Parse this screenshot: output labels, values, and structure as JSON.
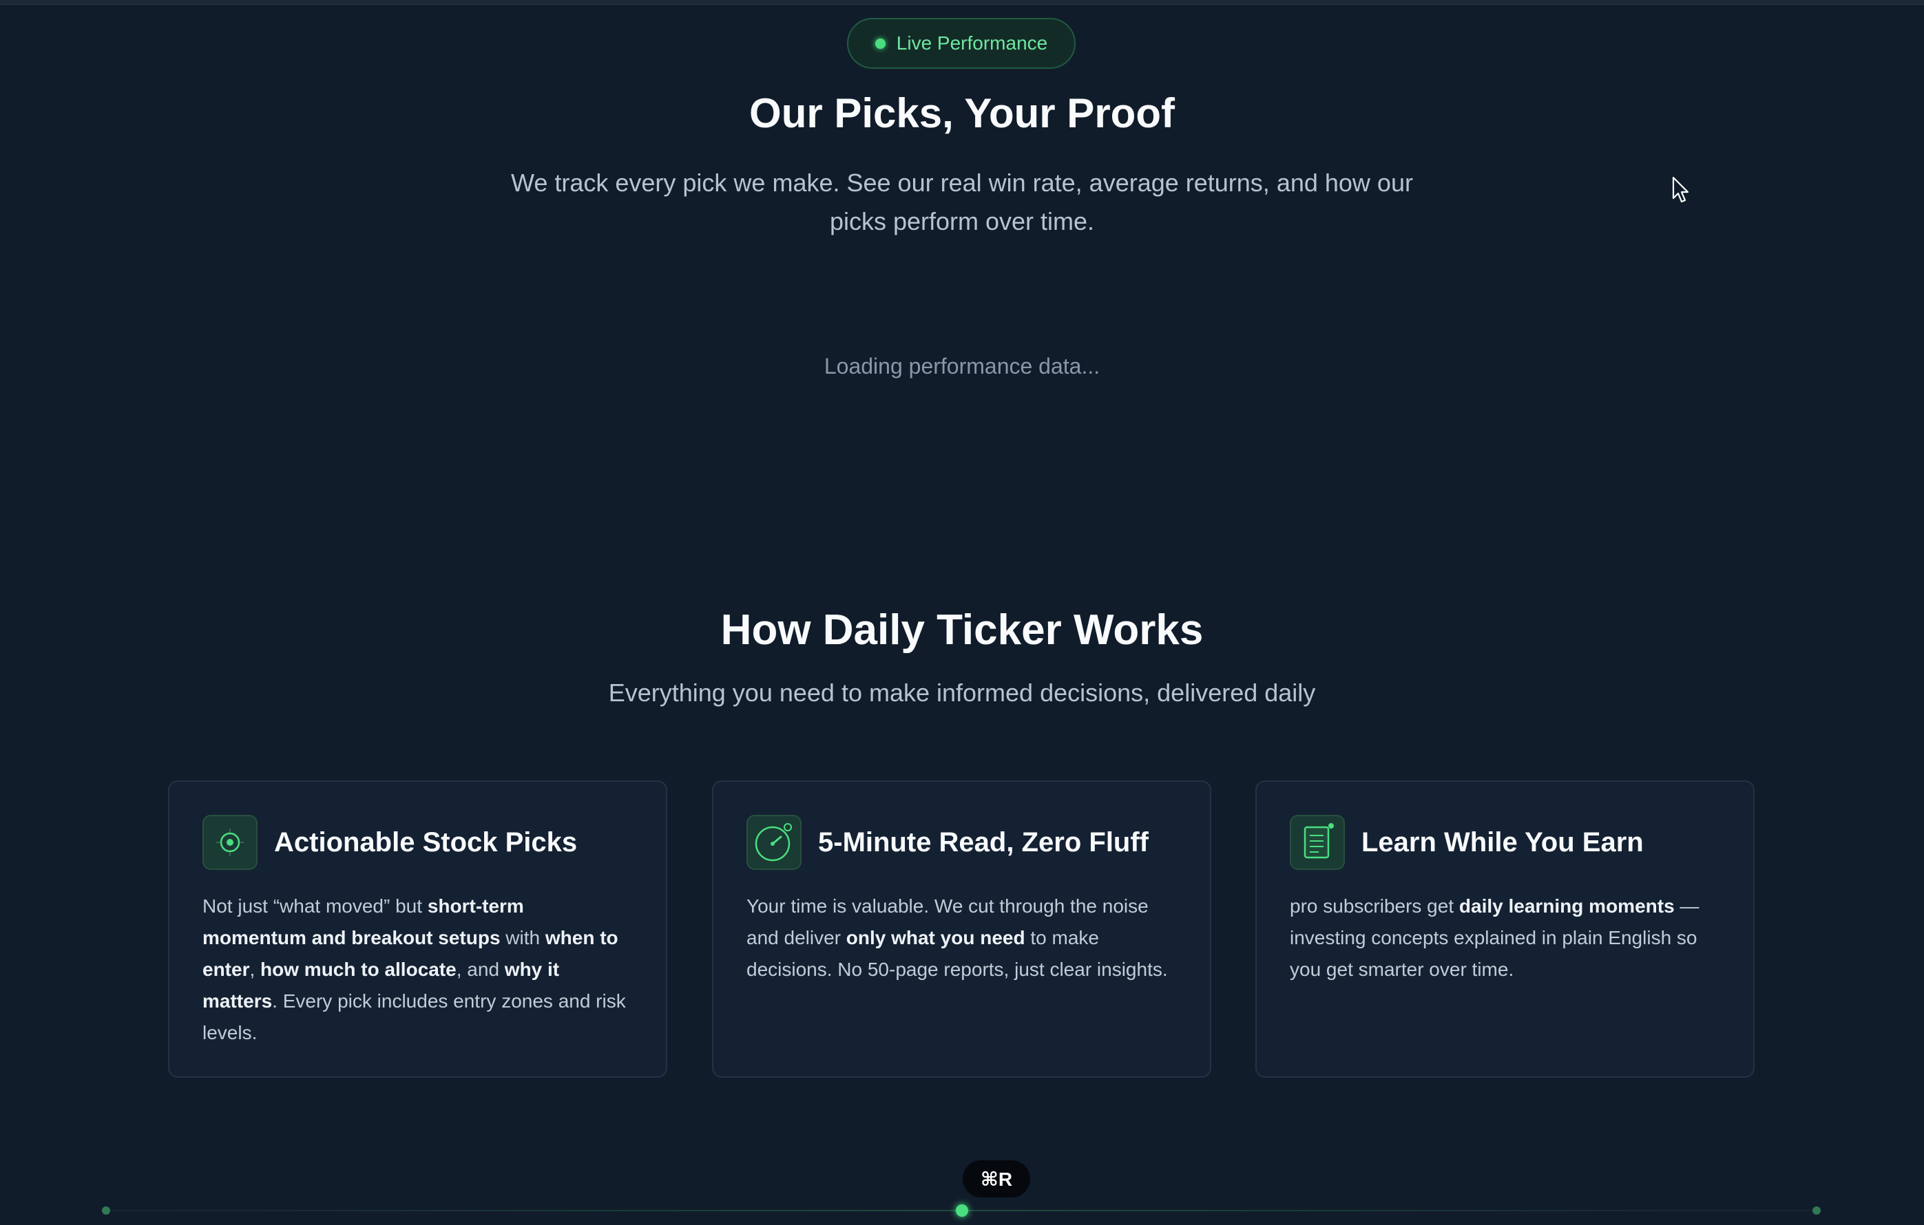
{
  "performance": {
    "badge_label": "Live Performance",
    "title": "Our Picks, Your Proof",
    "subtitle": "We track every pick we make. See our real win rate, average returns, and how our picks perform over time.",
    "loading_text": "Loading performance data..."
  },
  "how_it_works": {
    "title": "How Daily Ticker Works",
    "subtitle": "Everything you need to make informed decisions, delivered daily",
    "cards": [
      {
        "icon": "target-icon",
        "title": "Actionable Stock Picks",
        "body": [
          {
            "text": "Not just “what moved” but ",
            "bold": false
          },
          {
            "text": "short-term momentum and breakout setups",
            "bold": true
          },
          {
            "text": " with ",
            "bold": false
          },
          {
            "text": "when to enter",
            "bold": true
          },
          {
            "text": ", ",
            "bold": false
          },
          {
            "text": "how much to allocate",
            "bold": true
          },
          {
            "text": ", and ",
            "bold": false
          },
          {
            "text": "why it matters",
            "bold": true
          },
          {
            "text": ". Every pick includes entry zones and risk levels.",
            "bold": false
          }
        ]
      },
      {
        "icon": "stopwatch-icon",
        "title": "5-Minute Read, Zero Fluff",
        "body": [
          {
            "text": "Your time is valuable. We cut through the noise and deliver ",
            "bold": false
          },
          {
            "text": "only what you need",
            "bold": true
          },
          {
            "text": " to make decisions. No 50-page reports, just clear insights.",
            "bold": false
          }
        ]
      },
      {
        "icon": "document-icon",
        "title": "Learn While You Earn",
        "body": [
          {
            "text": "pro subscribers get ",
            "bold": false
          },
          {
            "text": "daily learning moments",
            "bold": true
          },
          {
            "text": " — investing concepts explained in plain English so you get smarter over time.",
            "bold": false
          }
        ]
      }
    ]
  },
  "shortcut_hint": "⌘R",
  "colors": {
    "background": "#111c2a",
    "accent": "#4ade80",
    "card_bg": "#142132",
    "card_border": "#223246"
  }
}
